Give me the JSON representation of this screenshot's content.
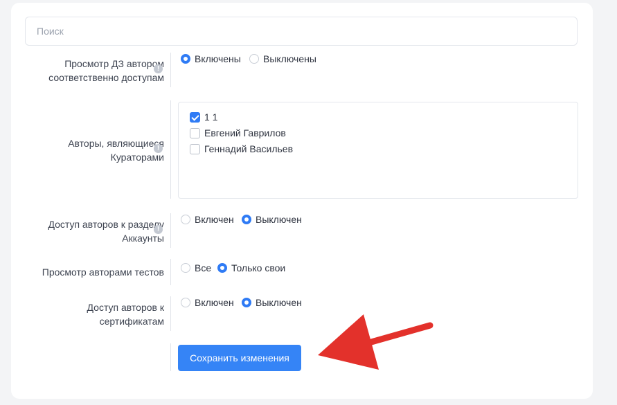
{
  "search": {
    "placeholder": "Поиск"
  },
  "settings": {
    "homework_view": {
      "label": "Просмотр ДЗ автором соответственно доступам",
      "options": [
        "Включены",
        "Выключены"
      ],
      "selected": "Включены"
    },
    "curator_authors": {
      "label": "Авторы, являющиеся Кураторами",
      "items": [
        {
          "label": "1 1",
          "checked": true
        },
        {
          "label": "Евгений Гаврилов",
          "checked": false
        },
        {
          "label": "Геннадий Васильев",
          "checked": false
        }
      ]
    },
    "accounts_access": {
      "label": "Доступ авторов к разделу Аккаунты",
      "options": [
        "Включен",
        "Выключен"
      ],
      "selected": "Выключен"
    },
    "tests_view": {
      "label": "Просмотр авторами тестов",
      "options": [
        "Все",
        "Только свои"
      ],
      "selected": "Только свои"
    },
    "certificates_access": {
      "label": "Доступ авторов к сертификатам",
      "options": [
        "Включен",
        "Выключен"
      ],
      "selected": "Выключен"
    }
  },
  "save_button": {
    "label": "Сохранить изменения"
  },
  "annotation": {
    "arrow_color": "#e3312b"
  },
  "colors": {
    "accent": "#3584f6"
  }
}
